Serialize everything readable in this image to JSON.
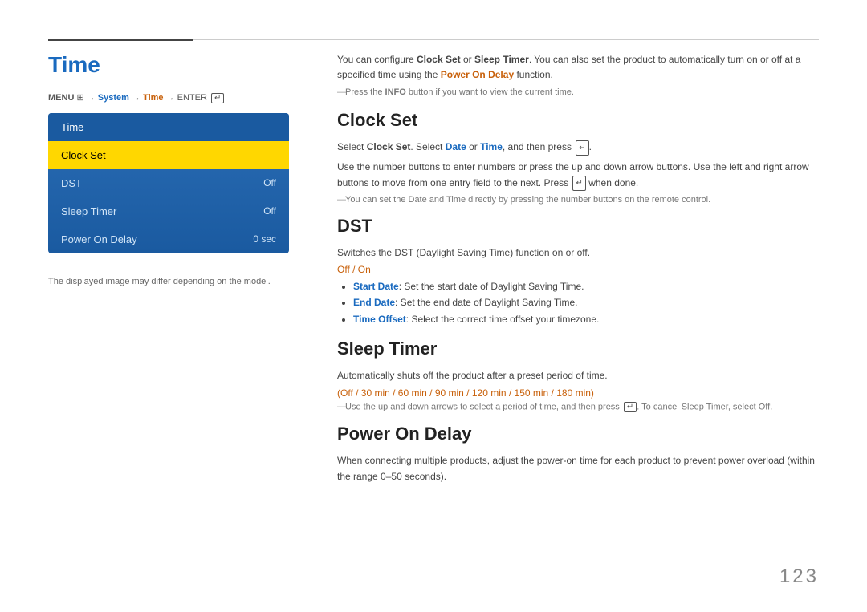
{
  "topbar": {},
  "left": {
    "title": "Time",
    "menu_path_prefix": "MENU",
    "menu_path": " → System → Time → ENTER",
    "panel_header": "Time",
    "menu_items": [
      {
        "label": "Clock Set",
        "value": "",
        "active": true
      },
      {
        "label": "DST",
        "value": "Off",
        "active": false
      },
      {
        "label": "Sleep Timer",
        "value": "Off",
        "active": false
      },
      {
        "label": "Power On Delay",
        "value": "0 sec",
        "active": false
      }
    ],
    "note": "The displayed image may differ depending on the model."
  },
  "right": {
    "intro": "You can configure Clock Set or Sleep Timer. You can also set the product to automatically turn on or off at a specified time using the Power On Delay function.",
    "intro_note": "Press the INFO button if you want to view the current time.",
    "sections": [
      {
        "id": "clock-set",
        "title": "Clock Set",
        "body1": "Select Clock Set. Select Date or Time, and then press .",
        "body2": "Use the number buttons to enter numbers or press the up and down arrow buttons. Use the left and right arrow buttons to move from one entry field to the next. Press  when done.",
        "sub_note": "You can set the Date and Time directly by pressing the number buttons on the remote control."
      },
      {
        "id": "dst",
        "title": "DST",
        "body1": "Switches the DST (Daylight Saving Time) function on or off.",
        "options_label": "Off / On",
        "bullets": [
          {
            "bold_label": "Start Date",
            "text": ": Set the start date of Daylight Saving Time."
          },
          {
            "bold_label": "End Date",
            "text": ": Set the end date of Daylight Saving Time."
          },
          {
            "bold_label": "Time Offset",
            "text": ": Select the correct time offset your timezone."
          }
        ]
      },
      {
        "id": "sleep-timer",
        "title": "Sleep Timer",
        "body1": "Automatically shuts off the product after a preset period of time.",
        "options_label": "(Off / 30 min / 60 min / 90 min / 120 min / 150 min / 180 min)",
        "sleep_note": "Use the up and down arrows to select a period of time, and then press . To cancel Sleep Timer, select Off."
      },
      {
        "id": "power-on-delay",
        "title": "Power On Delay",
        "body1": "When connecting multiple products, adjust the power-on time for each product to prevent power overload (within the range 0–50 seconds)."
      }
    ]
  },
  "page_number": "123"
}
